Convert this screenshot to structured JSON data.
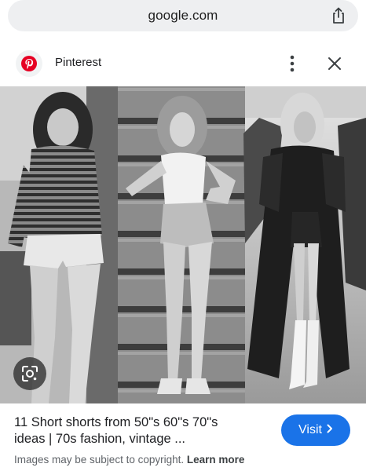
{
  "browser": {
    "url": "google.com",
    "share_icon": "share-icon"
  },
  "source": {
    "name": "Pinterest",
    "logo_icon": "pinterest-logo",
    "more_icon": "more-vert-icon",
    "close_icon": "close-icon"
  },
  "image": {
    "lens_icon": "google-lens-icon"
  },
  "result": {
    "title_line1": "11 Short shorts from 50\"s 60\"s 70\"s",
    "title_line2": "ideas | 70s fashion, vintage ...",
    "visit_label": "Visit",
    "copyright_text": "Images may be subject to copyright.",
    "learn_more": "Learn more"
  },
  "colors": {
    "accent": "#1a73e8",
    "pinterest_red": "#e60023",
    "url_bar_bg": "#eeeff1"
  }
}
